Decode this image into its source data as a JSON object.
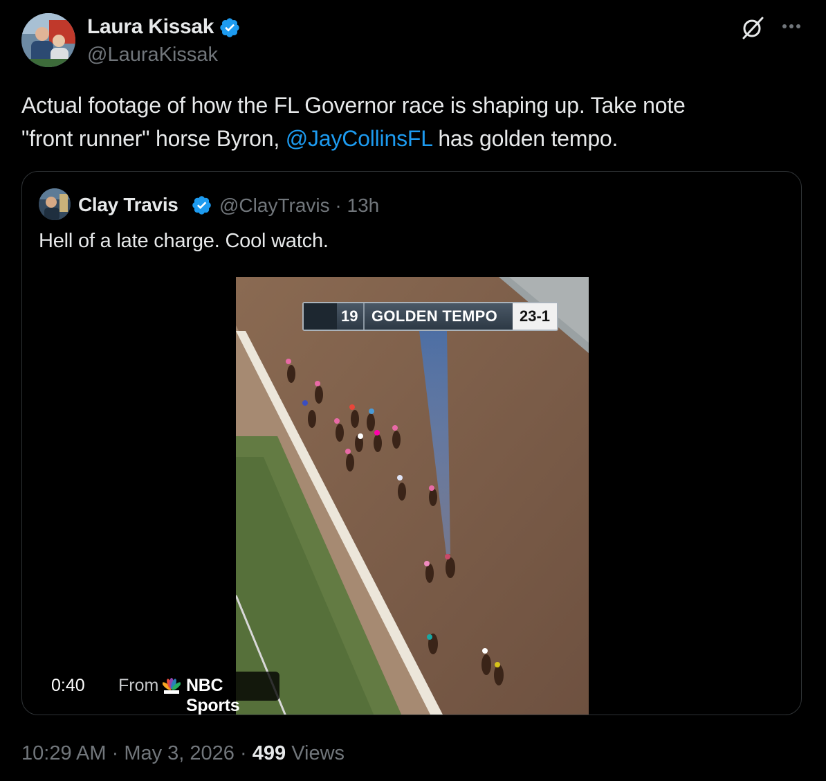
{
  "author": {
    "name": "Laura Kissak",
    "handle": "@LauraKissak"
  },
  "tweet": {
    "text_line1": "Actual footage of how the FL Governor race is shaping up. Take note",
    "text_line2_before": "\"front runner\" horse Byron, ",
    "mention": "@JayCollinsFL",
    "text_line2_after": " has golden tempo."
  },
  "quoted": {
    "name": "Clay Travis",
    "handle": "@ClayTravis",
    "separator": "·",
    "age": "13h",
    "text": "Hell of a late charge. Cool watch."
  },
  "video": {
    "scoreboard_number": "19",
    "scoreboard_horse": "GOLDEN TEMPO",
    "scoreboard_odds": "23-1",
    "duration": "0:40",
    "from_label": "From",
    "source": "NBC Sports"
  },
  "footer": {
    "time": "10:29 AM",
    "separator": "·",
    "date": "May 3, 2026",
    "views_count": "499",
    "views_label": "Views"
  },
  "colors": {
    "background": "#000000",
    "text": "#e7e9ea",
    "muted": "#71767b",
    "link": "#1d9bf0",
    "verified": "#1d9bf0",
    "border": "#2f3336"
  },
  "icons": [
    "verified-badge-icon",
    "grok-icon",
    "more-options-icon",
    "nbc-peacock-icon"
  ]
}
